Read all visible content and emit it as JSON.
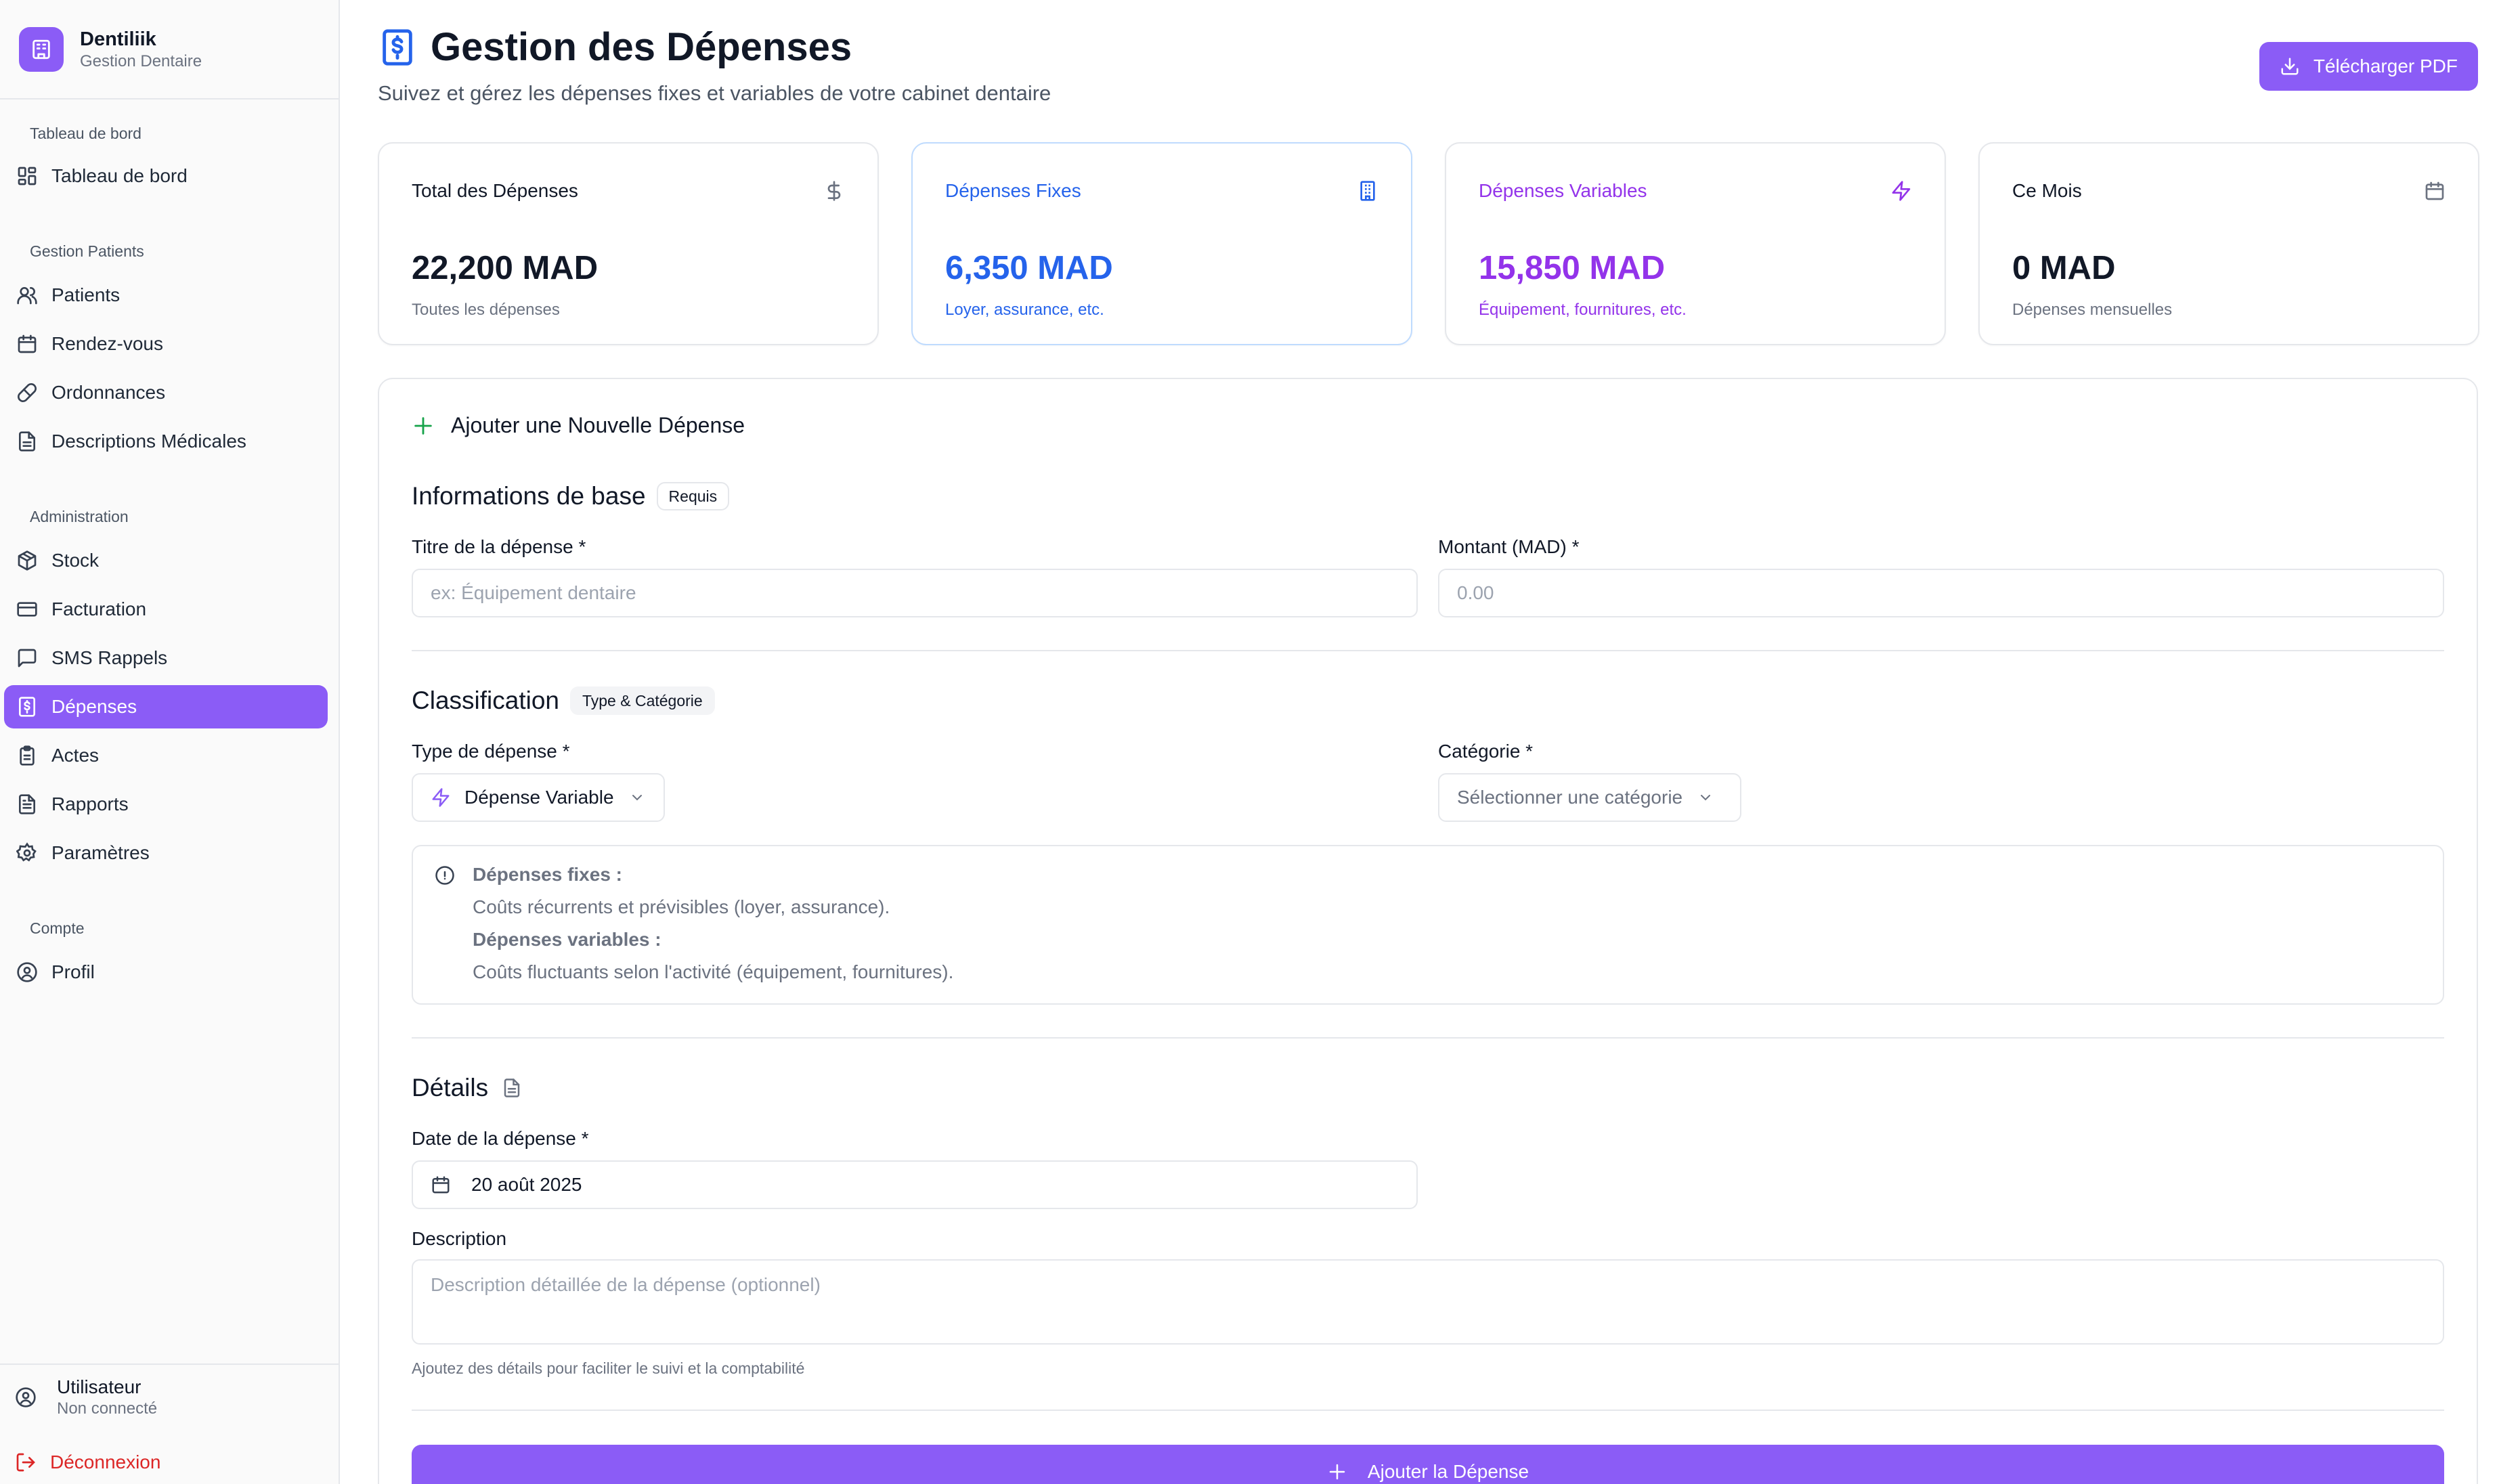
{
  "brand": {
    "name": "Dentiliik",
    "subtitle": "Gestion Dentaire"
  },
  "sidebar": {
    "sections": [
      {
        "title": "Tableau de bord",
        "items": [
          {
            "label": "Tableau de bord",
            "icon": "grid-icon"
          }
        ]
      },
      {
        "title": "Gestion Patients",
        "items": [
          {
            "label": "Patients",
            "icon": "users-icon"
          },
          {
            "label": "Rendez-vous",
            "icon": "calendar-icon"
          },
          {
            "label": "Ordonnances",
            "icon": "pill-icon"
          },
          {
            "label": "Descriptions Médicales",
            "icon": "file-text-icon"
          }
        ]
      },
      {
        "title": "Administration",
        "items": [
          {
            "label": "Stock",
            "icon": "package-icon"
          },
          {
            "label": "Facturation",
            "icon": "credit-card-icon"
          },
          {
            "label": "SMS Rappels",
            "icon": "message-square-icon"
          },
          {
            "label": "Dépenses",
            "icon": "receipt-icon",
            "active": true
          },
          {
            "label": "Actes",
            "icon": "clipboard-icon"
          },
          {
            "label": "Rapports",
            "icon": "file-report-icon"
          },
          {
            "label": "Paramètres",
            "icon": "settings-icon"
          }
        ]
      },
      {
        "title": "Compte",
        "items": [
          {
            "label": "Profil",
            "icon": "user-circle-icon"
          }
        ]
      }
    ],
    "footer": {
      "user_name": "Utilisateur",
      "user_status": "Non connecté",
      "logout_label": "Déconnexion"
    }
  },
  "header": {
    "title": "Gestion des Dépenses",
    "subtitle": "Suivez et gérez les dépenses fixes et variables de votre cabinet dentaire",
    "pdf_button": "Télécharger PDF"
  },
  "stats": [
    {
      "label": "Total des Dépenses",
      "value": "22,200 MAD",
      "sub": "Toutes les dépenses",
      "icon": "dollar-icon",
      "color": "#111827"
    },
    {
      "label": "Dépenses Fixes",
      "value": "6,350 MAD",
      "sub": "Loyer, assurance, etc.",
      "icon": "building-icon",
      "color": "#2563eb"
    },
    {
      "label": "Dépenses Variables",
      "value": "15,850 MAD",
      "sub": "Équipement, fournitures, etc.",
      "icon": "zap-icon",
      "color": "#9333ea"
    },
    {
      "label": "Ce Mois",
      "value": "0 MAD",
      "sub": "Dépenses mensuelles",
      "icon": "calendar-icon",
      "color": "#111827"
    }
  ],
  "form": {
    "title": "Ajouter une Nouvelle Dépense",
    "basic": {
      "title": "Informations de base",
      "badge": "Requis",
      "title_label": "Titre de la dépense *",
      "title_placeholder": "ex: Équipement dentaire",
      "amount_label": "Montant (MAD) *",
      "amount_placeholder": "0.00"
    },
    "classification": {
      "title": "Classification",
      "badge": "Type & Catégorie",
      "type_label": "Type de dépense *",
      "type_value": "Dépense Variable",
      "category_label": "Catégorie *",
      "category_placeholder": "Sélectionner une catégorie",
      "info": {
        "fixed_title": "Dépenses fixes :",
        "fixed_desc": "Coûts récurrents et prévisibles (loyer, assurance).",
        "variable_title": "Dépenses variables :",
        "variable_desc": "Coûts fluctuants selon l'activité (équipement, fournitures)."
      }
    },
    "details": {
      "title": "Détails",
      "date_label": "Date de la dépense *",
      "date_value": "20 août 2025",
      "description_label": "Description",
      "description_placeholder": "Description détaillée de la dépense (optionnel)",
      "hint": "Ajoutez des détails pour faciliter le suivi et la comptabilité"
    },
    "submit": "Ajouter la Dépense"
  },
  "colors": {
    "accent": "#8b5cf6",
    "blue": "#2563eb",
    "purple": "#9333ea",
    "danger": "#dc2626",
    "success": "#16a34a"
  }
}
